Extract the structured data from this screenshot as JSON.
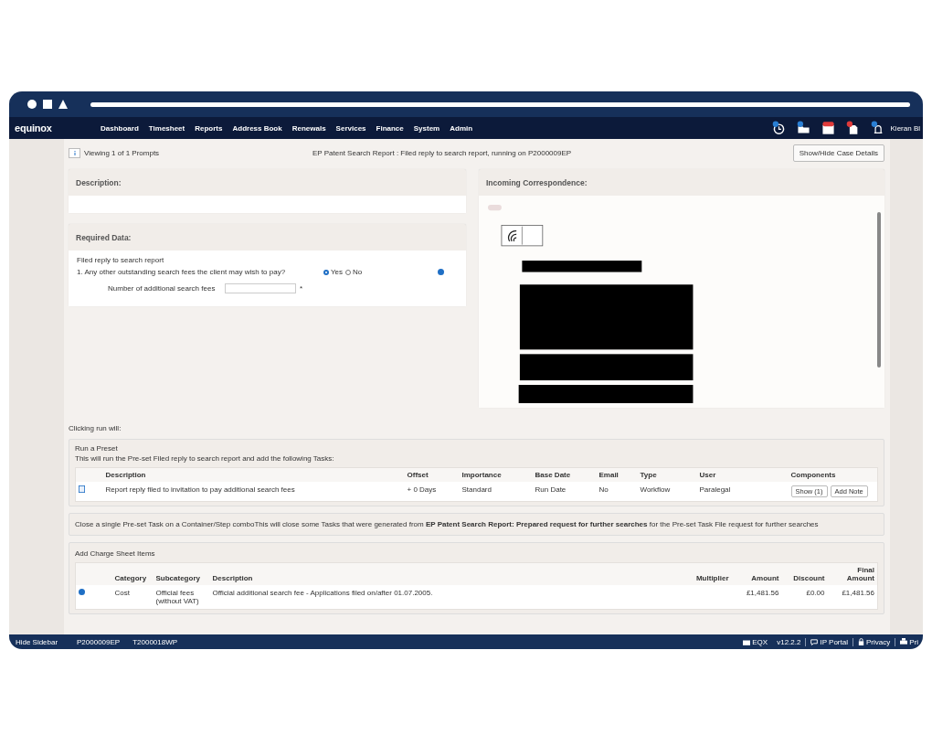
{
  "nav": {
    "logo": "equinox",
    "menu": [
      "Dashboard",
      "Timesheet",
      "Reports",
      "Address Book",
      "Renewals",
      "Services",
      "Finance",
      "System",
      "Admin"
    ],
    "user": "Kieran Bl"
  },
  "prompt_bar": {
    "counter": "Viewing 1 of 1 Prompts",
    "title": "EP Patent Search Report : Filed reply to search report, running on P2000009EP",
    "button": "Show/Hide Case Details"
  },
  "description_panel": {
    "title": "Description:"
  },
  "required_data": {
    "title": "Required Data:",
    "subtitle": "Filed reply to search report",
    "question": "1. Any other outstanding search fees the client may wish to pay?",
    "options": [
      {
        "label": "Yes",
        "selected": true
      },
      {
        "label": "No",
        "selected": false
      }
    ],
    "field_label": "Number of additional search fees",
    "required_mark": "*"
  },
  "correspondence": {
    "title": "Incoming Correspondence:"
  },
  "run_intro": "Clicking run will:",
  "preset": {
    "title": "Run a Preset",
    "text": "This will run the Pre-set Filed reply to search report and add the following Tasks:",
    "columns": [
      "Description",
      "Offset",
      "Importance",
      "Base Date",
      "Email",
      "Type",
      "User",
      "Components"
    ],
    "rows": [
      {
        "description": "Report reply filed to invitation to pay additional search fees",
        "offset": "+ 0 Days",
        "importance": "Standard",
        "base_date": "Run Date",
        "email": "No",
        "type": "Workflow",
        "user": "Paralegal",
        "buttons": [
          "Show (1)",
          "Add Note"
        ]
      }
    ]
  },
  "close_task": {
    "text": "Close a single Pre-set Task on a Container/Step comboThis will close some Tasks that were generated from **EP Patent Search Report: Prepared request for further searches** for the Pre-set Task File request for further searches"
  },
  "charges": {
    "title": "Add Charge Sheet Items",
    "columns": [
      "Category",
      "Subcategory",
      "Description",
      "Multiplier",
      "Amount",
      "Discount",
      "Final Amount"
    ],
    "rows": [
      {
        "category": "Cost",
        "subcategory": "Official fees (without VAT)",
        "description": "Official additional search fee - Applications filed on/after 01.07.2005.",
        "amount": "£1,481.56",
        "discount": "£0.00",
        "final_amount": "£1,481.56"
      }
    ]
  },
  "footer": {
    "hide_sidebar": "Hide Sidebar",
    "case_refs": [
      "P2000009EP",
      "T2000018WP"
    ],
    "links": [
      {
        "label": "EQX",
        "kind": "icon"
      },
      {
        "label": "v12.2.2",
        "kind": "text"
      },
      {
        "label": "IP Portal",
        "kind": "icon"
      },
      {
        "label": "Privacy",
        "kind": "icon"
      },
      {
        "label": "Pri",
        "kind": "icon"
      }
    ]
  }
}
